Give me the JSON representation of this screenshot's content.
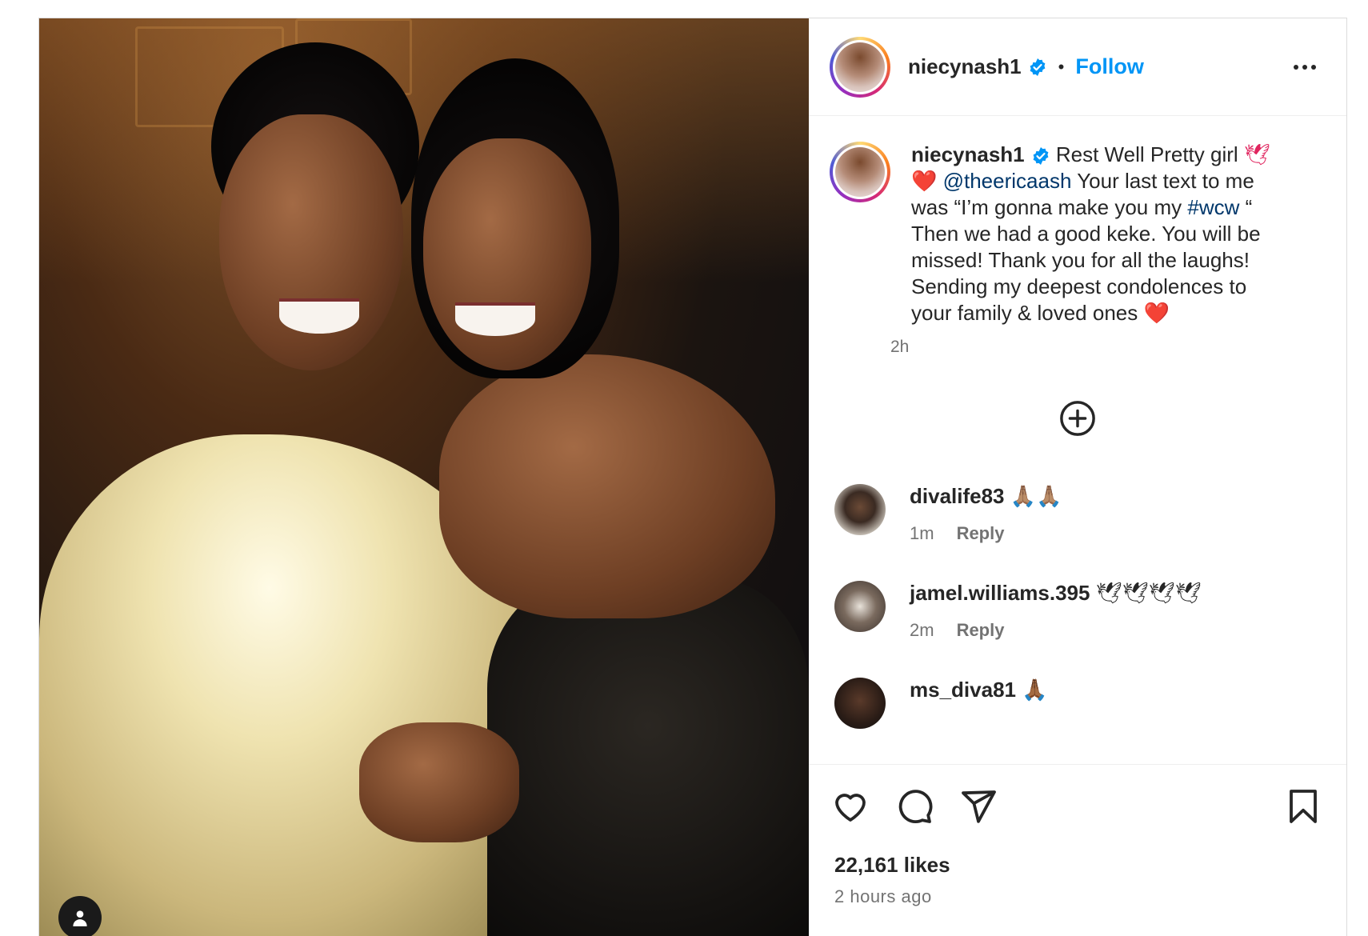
{
  "post": {
    "username": "niecynash1",
    "separator": "•",
    "follow_label": "Follow",
    "more_icon": "more-options-icon",
    "caption": {
      "username": "niecynash1",
      "text_1": "Rest Well Pretty girl",
      "emoji_1": "🕊❤️",
      "mention": "@theericaash",
      "text_2": "Your last text to me was “I’m gonna make you my",
      "hashtag": "#wcw",
      "text_3": "“ Then we had a good keke. You will be missed! Thank you for all the laughs! Sending my deepest condolences to your family & loved ones",
      "emoji_2": "❤️",
      "time": "2h"
    },
    "comments": [
      {
        "username": "divalife83",
        "text": "🙏🏽🙏🏽",
        "time": "1m",
        "reply": "Reply"
      },
      {
        "username": "jamel.williams.395",
        "text": "🕊🕊🕊🕊",
        "time": "2m",
        "reply": "Reply"
      },
      {
        "username": "ms_diva81",
        "text": "🙏🏾"
      }
    ],
    "likes": "22,161 likes",
    "posted_ago": "2 hours ago"
  },
  "colors": {
    "follow": "#0095f6",
    "link": "#00376b",
    "muted": "#737373",
    "verified": "#0095f6"
  },
  "icons": [
    "verified-badge-icon",
    "add-comment-icon",
    "heart-icon",
    "comment-icon",
    "share-icon",
    "save-icon",
    "user-tag-icon"
  ]
}
